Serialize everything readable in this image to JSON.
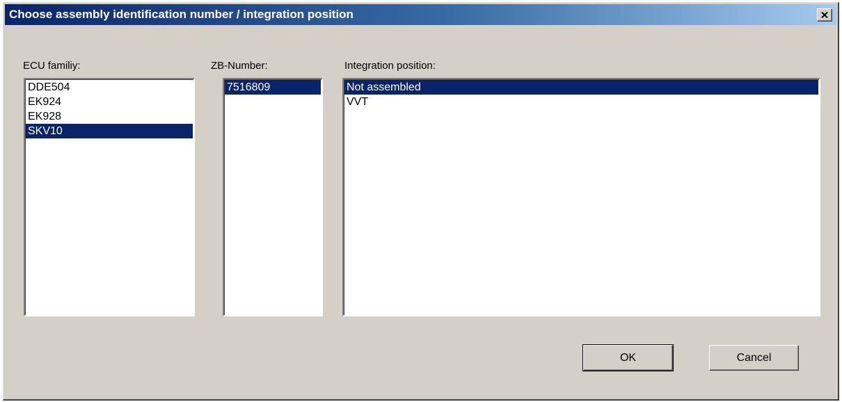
{
  "window": {
    "title": "Choose assembly identification number / integration position"
  },
  "columns": {
    "ecu_family": {
      "label": "ECU familiy:",
      "items": [
        "DDE504",
        "EK924",
        "EK928",
        "SKV10"
      ],
      "selected": 3
    },
    "zb_number": {
      "label": "ZB-Number:",
      "items": [
        "7516809"
      ],
      "selected": 0
    },
    "integration_position": {
      "label": "Integration position:",
      "items": [
        "Not assembled",
        "VVT"
      ],
      "selected": 0
    }
  },
  "buttons": {
    "ok_label": "OK",
    "cancel_label": "Cancel"
  },
  "colors": {
    "selection": "#0a246a",
    "face": "#d4d0c8"
  }
}
